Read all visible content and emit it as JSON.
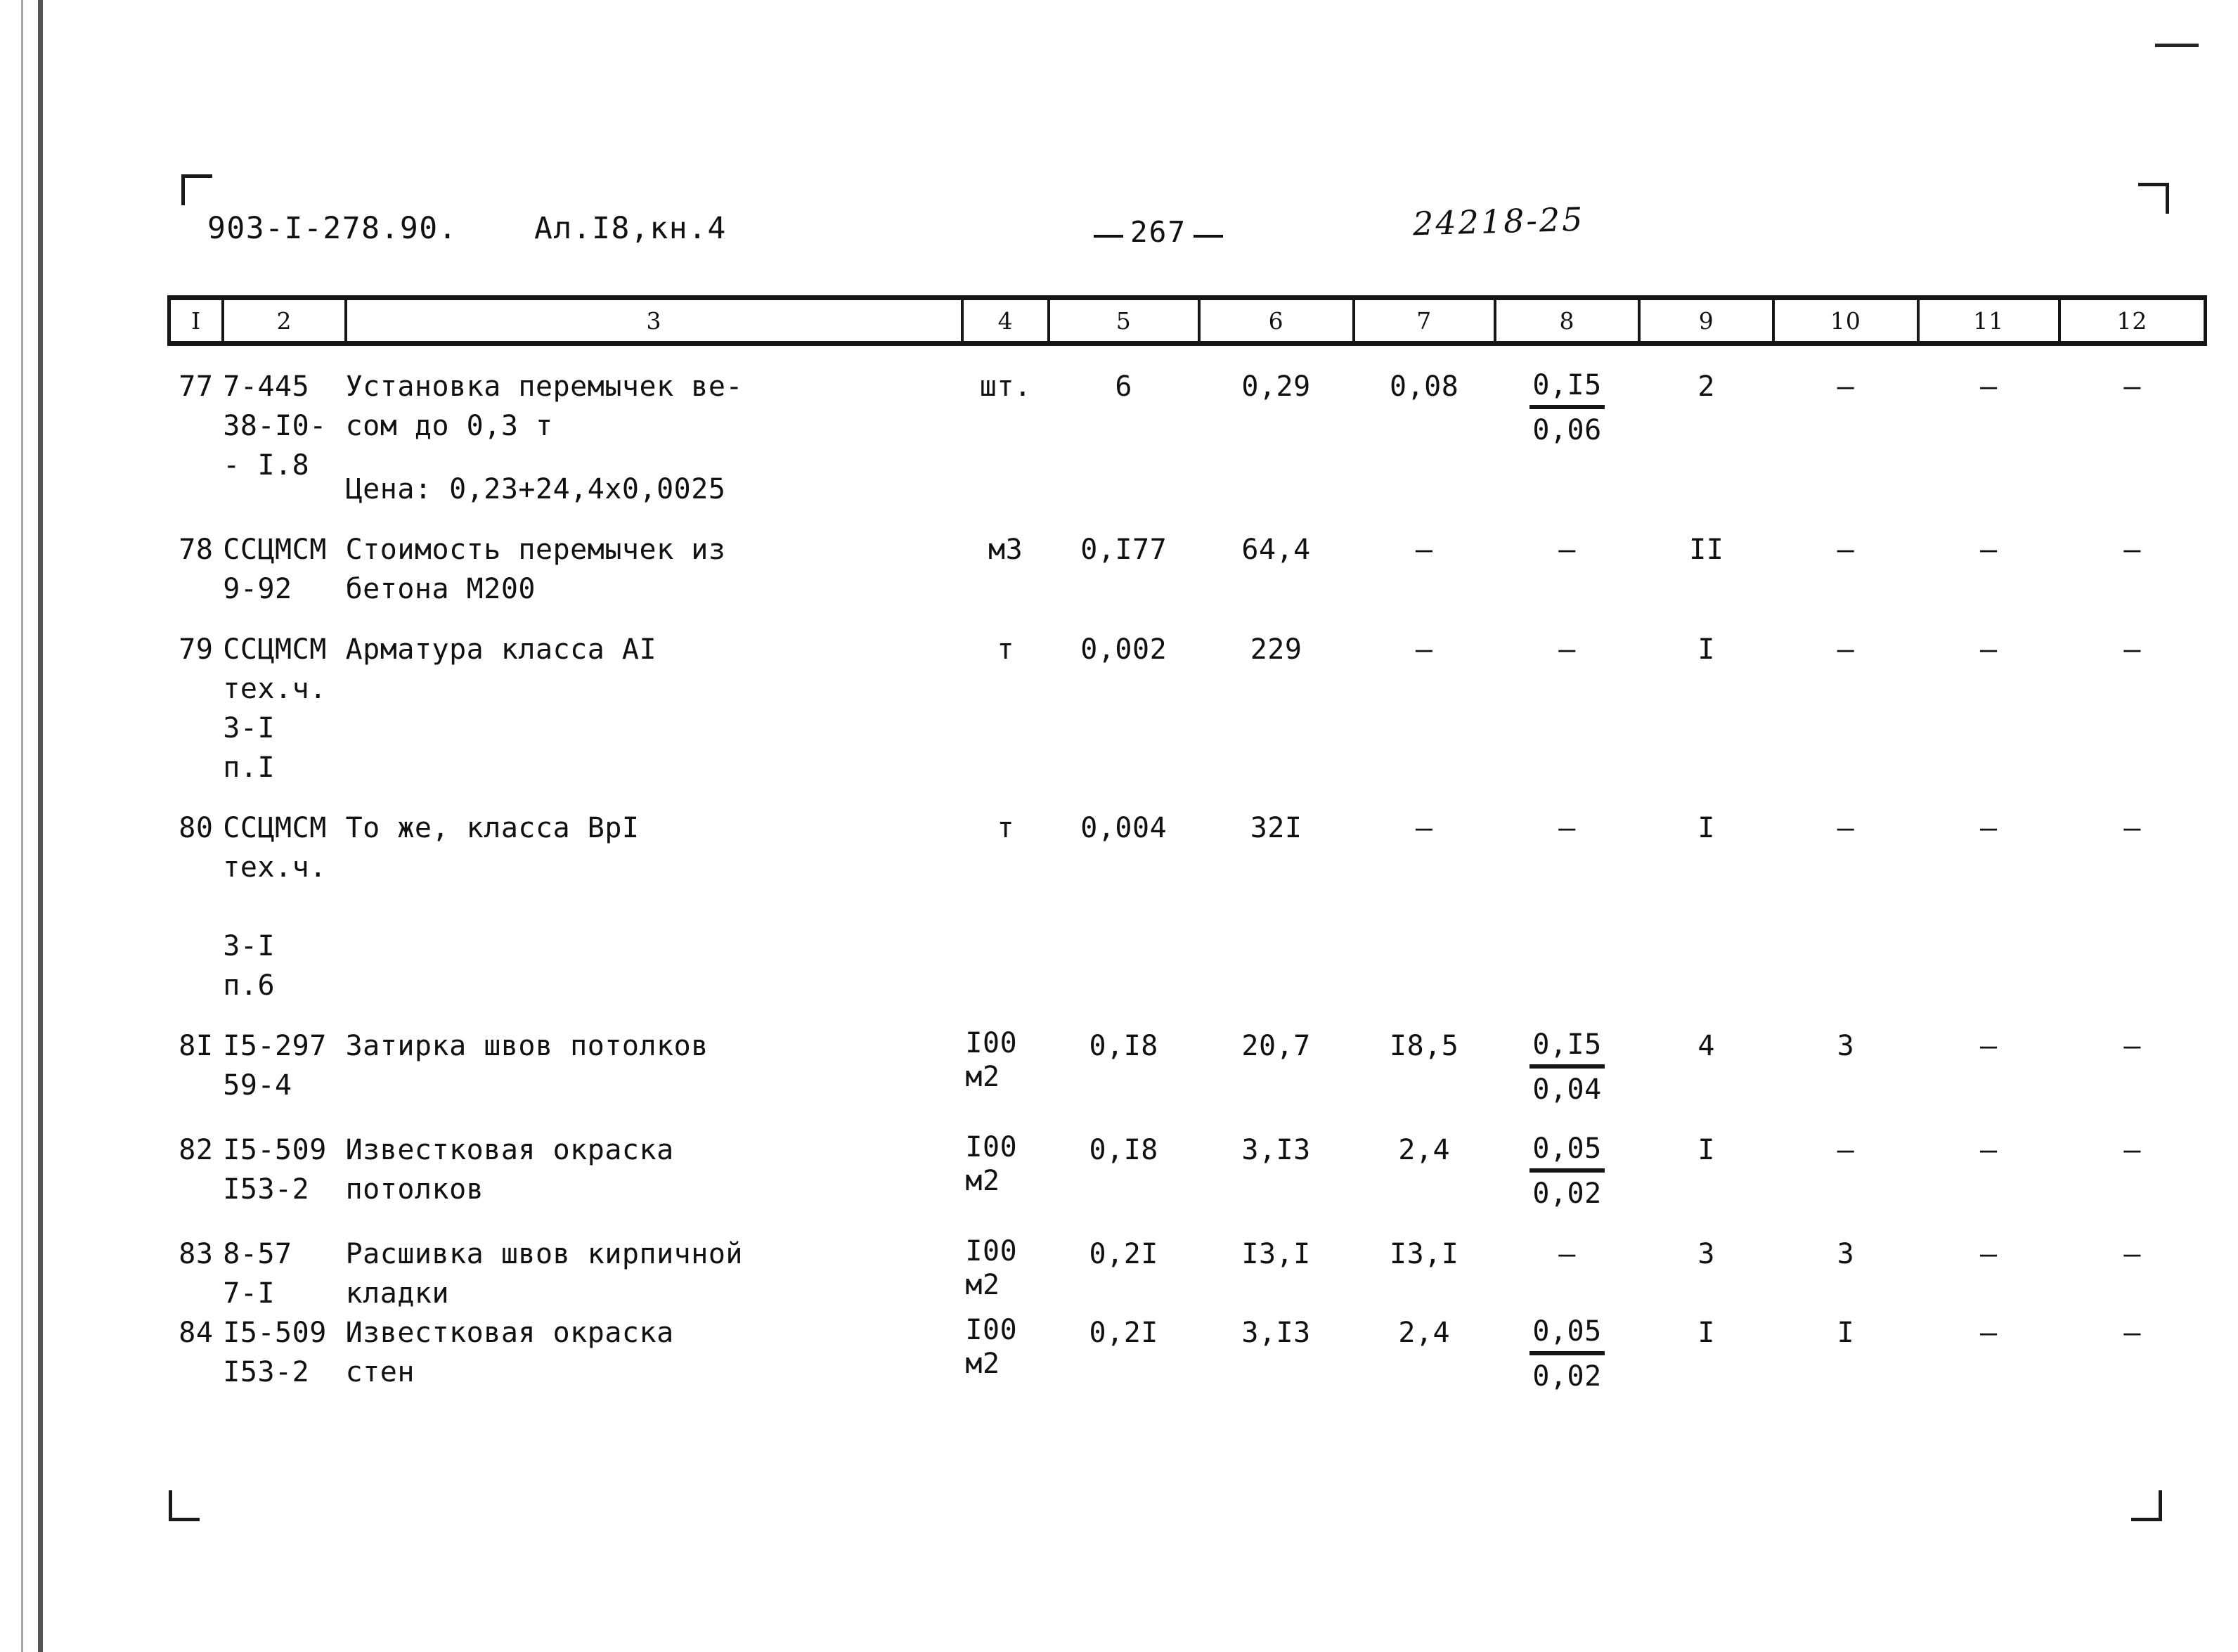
{
  "header": {
    "doc_code": "903-I-278.90.",
    "album": "Ал.I8,кн.4",
    "page_number": "267",
    "stamp": "24218-25"
  },
  "table": {
    "column_headers": [
      "I",
      "2",
      "3",
      "4",
      "5",
      "6",
      "7",
      "8",
      "9",
      "10",
      "11",
      "12"
    ],
    "rows": [
      {
        "num": "77",
        "code": "7-445\n38-I0-\n- I.8",
        "desc": "Установка перемычек ве-\nсом до 0,3 т",
        "price_note": "Цена: 0,23+24,4х0,0025",
        "unit": "шт.",
        "c5": "6",
        "c6": "0,29",
        "c7": "0,08",
        "c8_top": "0,I5",
        "c8_bot": "0,06",
        "c9": "2",
        "c10": "–",
        "c11": "–",
        "c12": "–"
      },
      {
        "num": "78",
        "code": "ССЦМСМ\n9-92",
        "desc": "Стоимость перемычек из\nбетона М200",
        "price_note": "",
        "unit": "м3",
        "c5": "0,I77",
        "c6": "64,4",
        "c7": "–",
        "c8": "–",
        "c9": "II",
        "c10": "–",
        "c11": "–",
        "c12": "–"
      },
      {
        "num": "79",
        "code": "ССЦМСМ\nтех.ч.\n3-I\nп.I",
        "desc": "Арматура класса АI",
        "price_note": "",
        "unit": "т",
        "c5": "0,002",
        "c6": "229",
        "c7": "–",
        "c8": "–",
        "c9": "I",
        "c10": "–",
        "c11": "–",
        "c12": "–"
      },
      {
        "num": "80",
        "code": "ССЦМСМ\nтех.ч.\n\n3-I\nп.6",
        "desc": "То же, класса ВрI",
        "price_note": "",
        "unit": "т",
        "c5": "0,004",
        "c6": "32I",
        "c7": "–",
        "c8": "–",
        "c9": "I",
        "c10": "–",
        "c11": "–",
        "c12": "–"
      },
      {
        "num": "8I",
        "code": "I5-297\n59-4",
        "desc": "Затирка швов потолков",
        "price_note": "",
        "unit": "I00\nм2",
        "c5": "0,I8",
        "c6": "20,7",
        "c7": "I8,5",
        "c8_top": "0,I5",
        "c8_bot": "0,04",
        "c9": "4",
        "c10": "3",
        "c11": "–",
        "c12": "–"
      },
      {
        "num": "82",
        "code": "I5-509\nI53-2",
        "desc": "Известковая окраска\nпотолков",
        "price_note": "",
        "unit": "I00\nм2",
        "c5": "0,I8",
        "c6": "3,I3",
        "c7": "2,4",
        "c8_top": "0,05",
        "c8_bot": "0,02",
        "c9": "I",
        "c10": "–",
        "c11": "–",
        "c12": "–"
      },
      {
        "num": "83",
        "code": "8-57\n7-I",
        "desc": "Расшивка швов кирпичной\nкладки",
        "price_note": "",
        "unit": "I00\nм2",
        "c5": "0,2I",
        "c6": "I3,I",
        "c7": "I3,I",
        "c8": "–",
        "c9": "3",
        "c10": "3",
        "c11": "–",
        "c12": "–"
      },
      {
        "num": "84",
        "code": "I5-509\nI53-2",
        "desc": "Известковая окраска\nстен",
        "price_note": "",
        "unit": "I00\nм2",
        "c5": "0,2I",
        "c6": "3,I3",
        "c7": "2,4",
        "c8_top": "0,05",
        "c8_bot": "0,02",
        "c9": "I",
        "c10": "I",
        "c11": "–",
        "c12": "–"
      }
    ]
  }
}
